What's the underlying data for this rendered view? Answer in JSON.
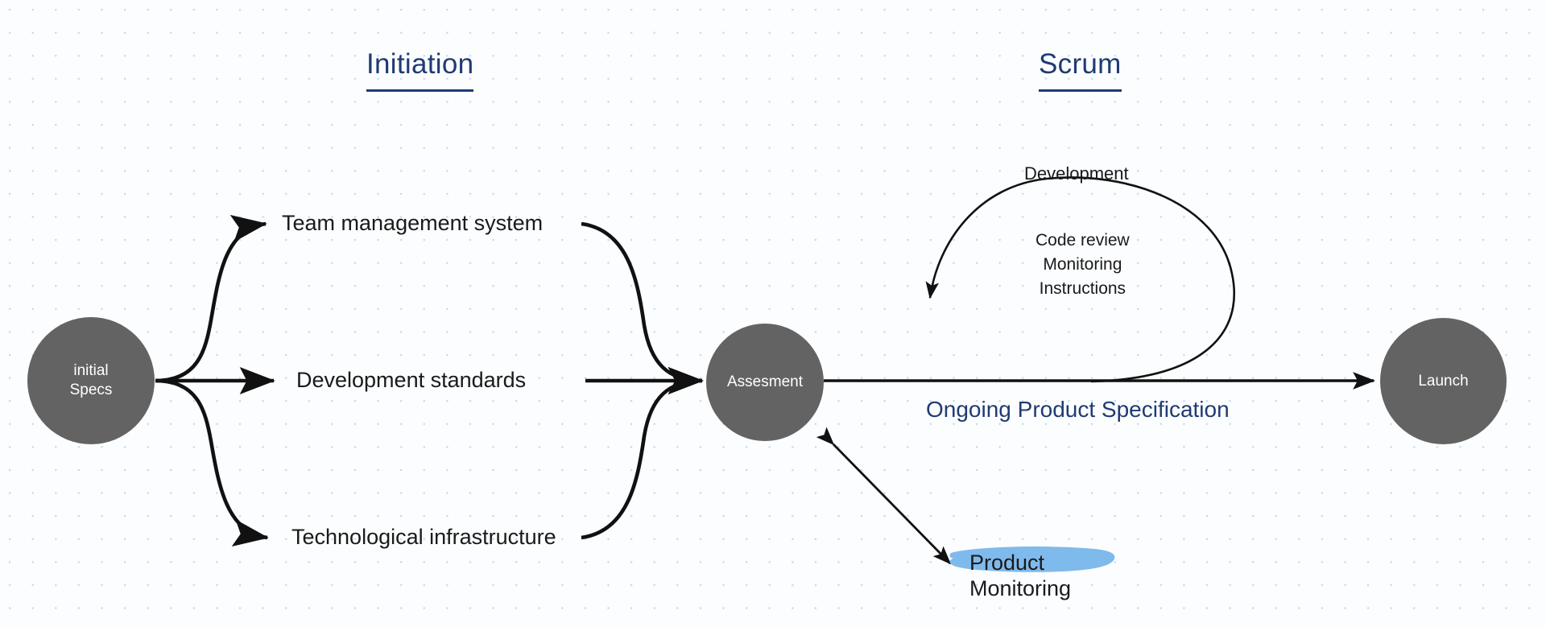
{
  "diagram": {
    "title_phases": [
      {
        "id": "initiation",
        "label": "Initiation"
      },
      {
        "id": "scrum",
        "label": "Scrum"
      }
    ],
    "nodes": [
      {
        "id": "initial-specs",
        "label": "initial\nSpecs",
        "shape": "circle",
        "fill": "#636363",
        "text_color": "#ffffff"
      },
      {
        "id": "assesment",
        "label": "Assesment",
        "shape": "circle",
        "fill": "#636363",
        "text_color": "#ffffff"
      },
      {
        "id": "launch",
        "label": "Launch",
        "shape": "circle",
        "fill": "#636363",
        "text_color": "#ffffff"
      }
    ],
    "branch_labels": [
      {
        "id": "team-management-system",
        "label": "Team management system"
      },
      {
        "id": "development-standards",
        "label": "Development standards"
      },
      {
        "id": "technological-infrastructure",
        "label": "Technological infrastructure"
      }
    ],
    "loop": {
      "title": "Development",
      "items_label": "Code review\nMonitoring\nInstructions",
      "items": [
        "Code review",
        "Monitoring",
        "Instructions"
      ]
    },
    "annotations": {
      "ongoing_spec": "Ongoing Product Specification",
      "product_monitoring": "Product\nMonitoring"
    },
    "colors": {
      "accent_blue": "#1f3b73",
      "node_fill": "#636363",
      "highlight_blue": "#7fbaec",
      "grid_dot": "#bfdcf2",
      "line": "#111111",
      "background": "#fcfdfe"
    }
  }
}
